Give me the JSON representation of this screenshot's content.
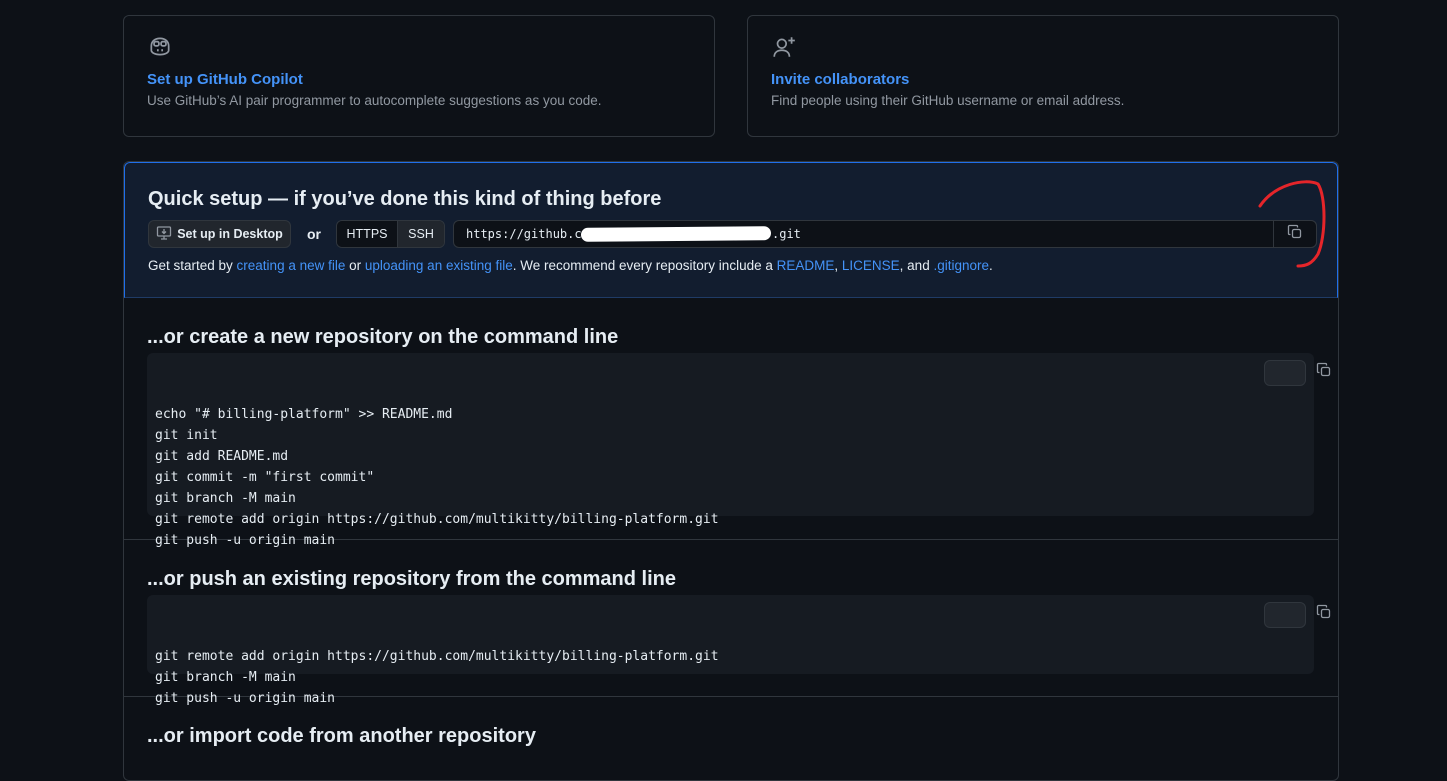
{
  "cards": [
    {
      "icon": "copilot-icon",
      "title": "Set up GitHub Copilot",
      "description": "Use GitHub’s AI pair programmer to autocomplete suggestions as you code."
    },
    {
      "icon": "person-add-icon",
      "title": "Invite collaborators",
      "description": "Find people using their GitHub username or email address."
    }
  ],
  "quick_setup": {
    "title": "Quick setup — if you’ve done this kind of thing before",
    "desktop_button": "Set up in Desktop",
    "or": "or",
    "https": "HTTPS",
    "ssh": "SSH",
    "url_prefix": "https://github.com",
    "url_suffix": ".git",
    "help": {
      "prefix": "Get started by ",
      "link1": "creating a new file",
      "mid1": " or ",
      "link2": "uploading an existing file",
      "mid2": ". We recommend every repository include a ",
      "link3": "README",
      "sep1": ", ",
      "link4": "LICENSE",
      "sep2": ", and ",
      "link5": ".gitignore",
      "end": "."
    }
  },
  "sections": [
    {
      "title": "...or create a new repository on the command line",
      "code": "echo \"# billing-platform\" >> README.md\ngit init\ngit add README.md\ngit commit -m \"first commit\"\ngit branch -M main\ngit remote add origin https://github.com/multikitty/billing-platform.git\ngit push -u origin main"
    },
    {
      "title": "...or push an existing repository from the command line",
      "code": "git remote add origin https://github.com/multikitty/billing-platform.git\ngit branch -M main\ngit push -u origin main"
    },
    {
      "title": "...or import code from another repository"
    }
  ],
  "colors": {
    "accent": "#4493f8",
    "background": "#0d1117",
    "annotation": "#e5252a"
  }
}
